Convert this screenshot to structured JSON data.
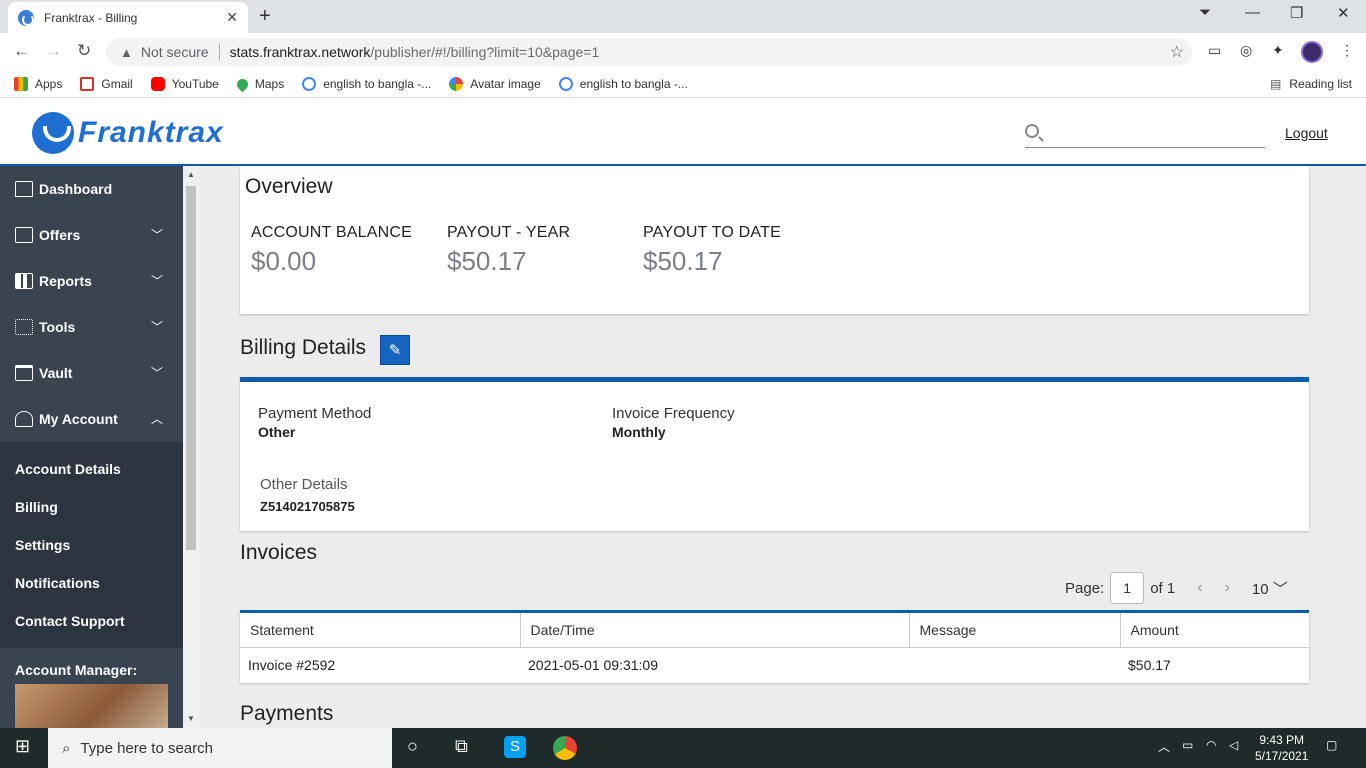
{
  "browser": {
    "tab_title": "Franktrax - Billing",
    "url_warning": "Not secure",
    "url_host": "stats.franktrax.network",
    "url_path": "/publisher/#!/billing?limit=10&page=1"
  },
  "bookmarks": {
    "items": [
      "Apps",
      "Gmail",
      "YouTube",
      "Maps",
      "english to bangla -...",
      "Avatar image",
      "english to bangla -..."
    ],
    "reading_list": "Reading list"
  },
  "header": {
    "logo_text": "Franktrax",
    "logout": "Logout"
  },
  "sidebar": {
    "items": [
      {
        "label": "Dashboard"
      },
      {
        "label": "Offers"
      },
      {
        "label": "Reports"
      },
      {
        "label": "Tools"
      },
      {
        "label": "Vault"
      },
      {
        "label": "My Account"
      }
    ],
    "submenu": [
      "Account Details",
      "Billing",
      "Settings",
      "Notifications",
      "Contact Support"
    ],
    "account_manager_label": "Account Manager:"
  },
  "overview": {
    "title": "Overview",
    "stats": [
      {
        "label": "ACCOUNT BALANCE",
        "value": "$0.00"
      },
      {
        "label": "PAYOUT - YEAR",
        "value": "$50.17"
      },
      {
        "label": "PAYOUT TO DATE",
        "value": "$50.17"
      }
    ]
  },
  "billing": {
    "title": "Billing Details",
    "payment_method_label": "Payment Method",
    "payment_method_value": "Other",
    "invoice_frequency_label": "Invoice Frequency",
    "invoice_frequency_value": "Monthly",
    "other_details_label": "Other Details",
    "other_details_value": "Z514021705875"
  },
  "invoices": {
    "title": "Invoices",
    "page_label": "Page:",
    "page_value": "1",
    "of_label": "of 1",
    "page_size": "10",
    "columns": [
      "Statement",
      "Date/Time",
      "Message",
      "Amount"
    ],
    "rows": [
      [
        "Invoice #2592",
        "2021-05-01 09:31:09",
        "",
        "$50.17"
      ]
    ]
  },
  "payments": {
    "title": "Payments"
  },
  "taskbar": {
    "search_placeholder": "Type here to search",
    "time": "9:43 PM",
    "date": "5/17/2021"
  },
  "colors": {
    "sidebar_bg": "#3a4350",
    "accent_blue": "#0b5cad",
    "stat_value": "#7a7f87"
  }
}
